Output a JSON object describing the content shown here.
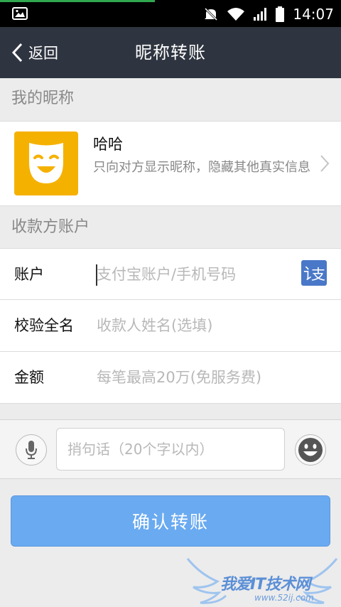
{
  "status_bar": {
    "time": "14:07",
    "icons": [
      "image-icon",
      "mute-icon",
      "wifi-icon",
      "signal-icon",
      "battery-icon"
    ]
  },
  "nav": {
    "back_label": "返回",
    "title": "昵称转账"
  },
  "my_nickname": {
    "section_title": "我的昵称",
    "name": "哈哈",
    "description": "只向对方显示昵称，隐藏其他真实信息",
    "avatar_icon": "mask-icon",
    "avatar_color": "#F5B100"
  },
  "payee": {
    "section_title": "收款方账户",
    "fields": [
      {
        "label": "账户",
        "placeholder": "支付宝账户/手机号码",
        "value": ""
      },
      {
        "label": "校验全名",
        "placeholder": "收款人姓名(选填)",
        "value": ""
      },
      {
        "label": "金额",
        "placeholder": "每笔最高20万(免服务费)",
        "value": ""
      }
    ],
    "contact_icon": "alipay-contact-icon"
  },
  "message": {
    "placeholder": "捎句话（20个字以内）",
    "voice_icon": "microphone-icon",
    "emoji_icon": "smiley-icon"
  },
  "confirm_label": "确认转账",
  "theme": {
    "nav_bg": "#2F3540",
    "button_bg": "#6AAAF0"
  }
}
